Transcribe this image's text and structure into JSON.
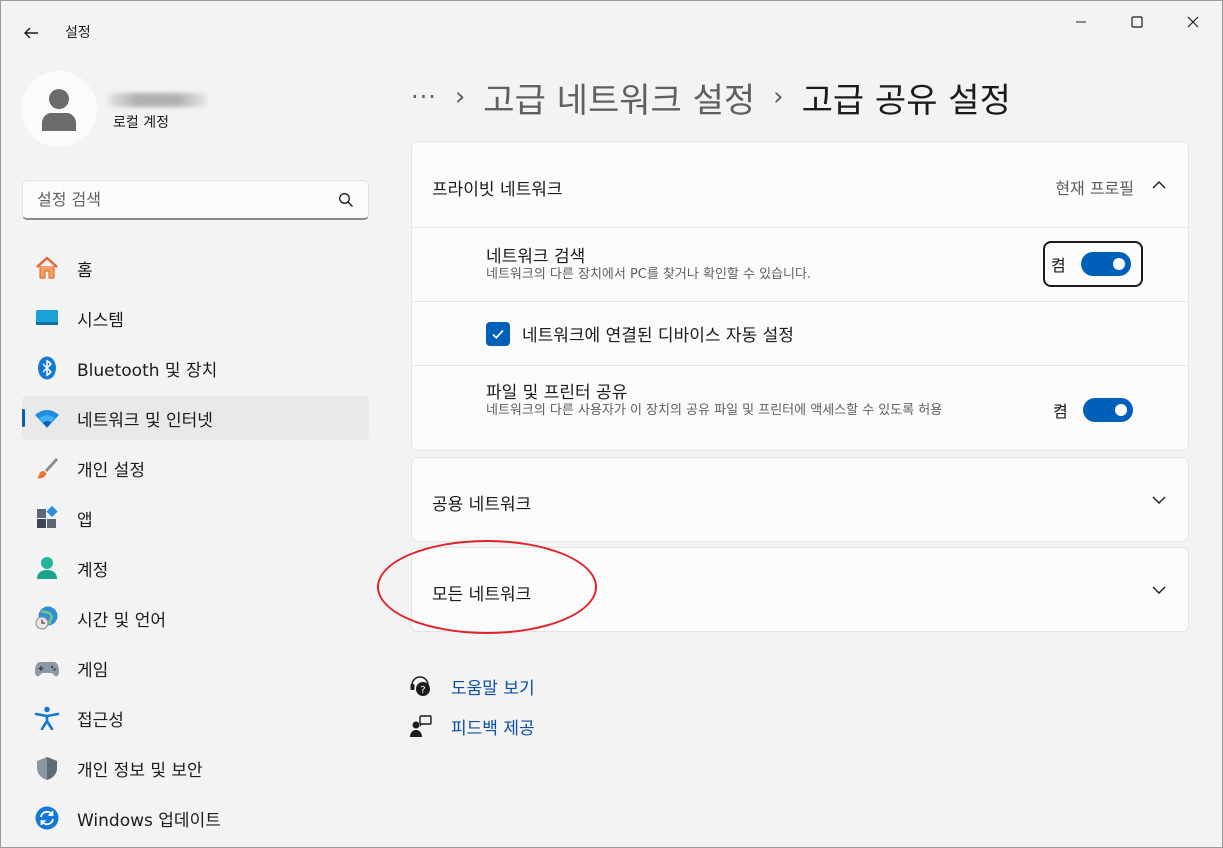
{
  "window": {
    "title": "설정",
    "back_icon": "back-arrow-icon",
    "controls": [
      "minimize-icon",
      "maximize-icon",
      "close-icon"
    ]
  },
  "profile": {
    "account_type": "로컬 계정"
  },
  "search": {
    "placeholder": "설정 검색"
  },
  "sidebar": {
    "items": [
      {
        "label": "홈",
        "icon": "home-icon"
      },
      {
        "label": "시스템",
        "icon": "system-icon"
      },
      {
        "label": "Bluetooth 및 장치",
        "icon": "bluetooth-icon"
      },
      {
        "label": "네트워크 및 인터넷",
        "icon": "network-icon",
        "active": true
      },
      {
        "label": "개인 설정",
        "icon": "brush-icon"
      },
      {
        "label": "앱",
        "icon": "apps-icon"
      },
      {
        "label": "계정",
        "icon": "account-icon"
      },
      {
        "label": "시간 및 언어",
        "icon": "time-language-icon"
      },
      {
        "label": "게임",
        "icon": "gamepad-icon"
      },
      {
        "label": "접근성",
        "icon": "accessibility-icon"
      },
      {
        "label": "개인 정보 및 보안",
        "icon": "shield-icon"
      },
      {
        "label": "Windows 업데이트",
        "icon": "update-icon"
      }
    ]
  },
  "breadcrumb": {
    "more": "···",
    "sep": "›",
    "parent": "고급 네트워크 설정",
    "current": "고급 공유 설정"
  },
  "private_network": {
    "title": "프라이빗 네트워크",
    "status": "현재 프로필",
    "discovery": {
      "title": "네트워크 검색",
      "desc": "네트워크의 다른 장치에서 PC를 찾거나 확인할 수 있습니다.",
      "state": "켬"
    },
    "auto_setup": {
      "label": "네트워크에 연결된 디바이스 자동 설정",
      "checked": true
    },
    "file_sharing": {
      "title": "파일 및 프린터 공유",
      "desc": "네트워크의 다른 사용자가 이 장치의 공유 파일 및 프린터에 액세스할 수 있도록 허용",
      "state": "켬"
    }
  },
  "public_network": {
    "title": "공용 네트워크"
  },
  "all_networks": {
    "title": "모든 네트워크"
  },
  "links": {
    "help": "도움말 보기",
    "feedback": "피드백 제공"
  },
  "colors": {
    "accent": "#005fb8",
    "annotation": "#e0232a"
  }
}
